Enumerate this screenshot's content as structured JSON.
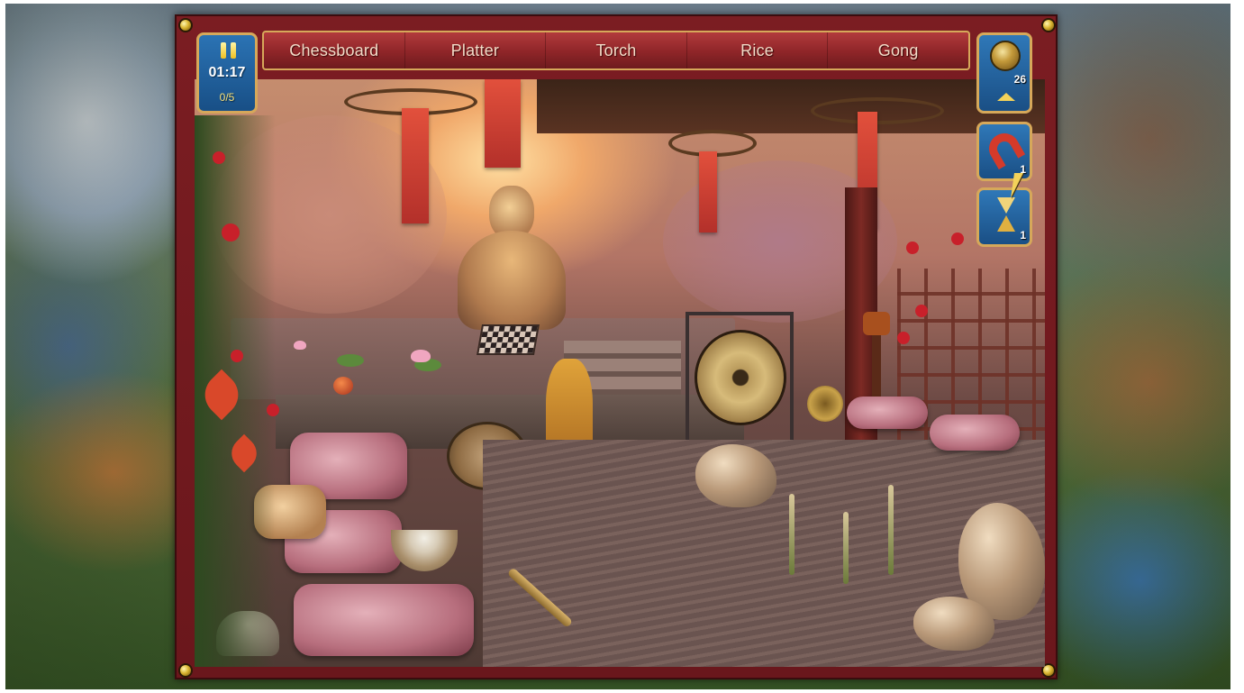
{
  "hud": {
    "timer": "01:17",
    "found_count": "0/5"
  },
  "item_list": [
    {
      "label": "Chessboard"
    },
    {
      "label": "Platter"
    },
    {
      "label": "Torch"
    },
    {
      "label": "Rice"
    },
    {
      "label": "Gong"
    }
  ],
  "tools": {
    "hint": {
      "icon": "compass-icon",
      "count": "26"
    },
    "magnet": {
      "icon": "magnet-icon",
      "count": "1"
    },
    "time": {
      "icon": "hourglass-icon",
      "count": "1"
    }
  },
  "colors": {
    "frame": "#7b1d22",
    "trim": "#d6a85a",
    "hud_blue": "#2b73b4",
    "item_text": "#f3dcc8"
  }
}
